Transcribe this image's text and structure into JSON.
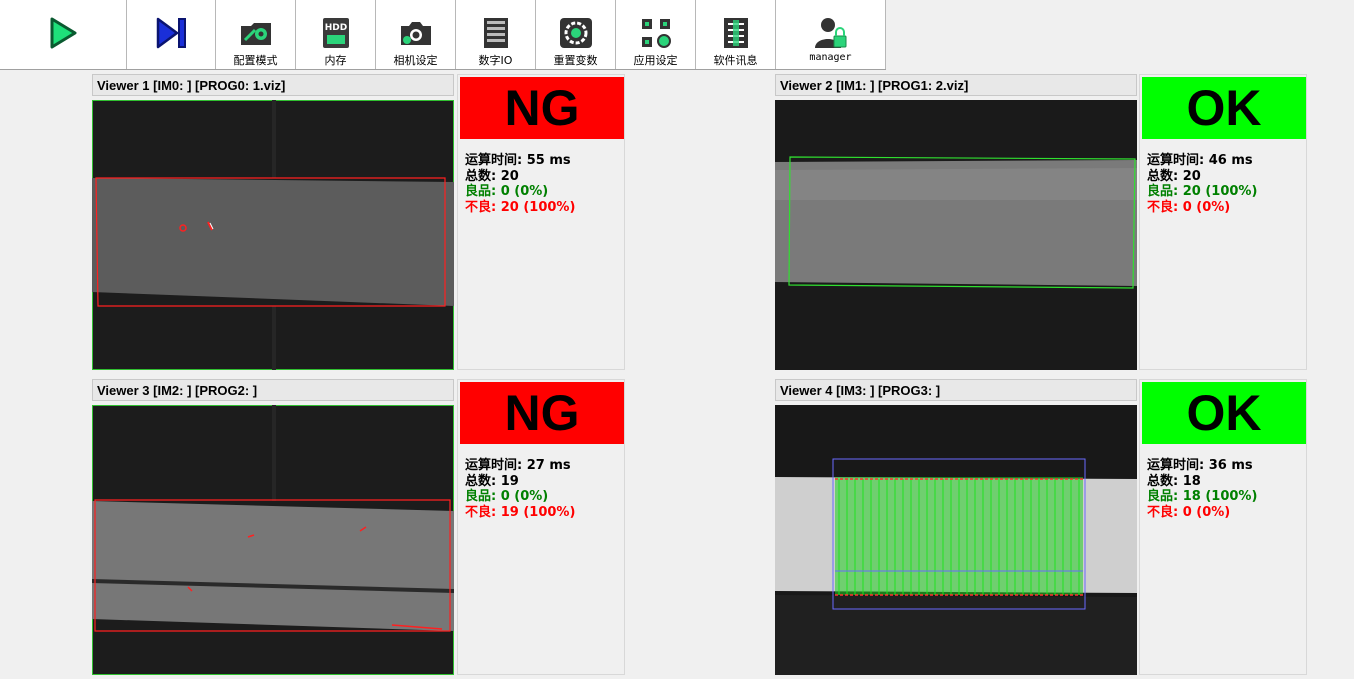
{
  "toolbar": {
    "buttons": [
      {
        "id": "run",
        "label": "",
        "icon": "play-icon"
      },
      {
        "id": "step",
        "label": "",
        "icon": "step-forward-icon"
      },
      {
        "id": "config-mode",
        "label": "配置模式",
        "icon": "folder-gear-icon"
      },
      {
        "id": "memory",
        "label": "内存",
        "icon": "hdd-icon"
      },
      {
        "id": "camera-settings",
        "label": "相机设定",
        "icon": "camera-gear-icon"
      },
      {
        "id": "digital-io",
        "label": "数字IO",
        "icon": "io-rack-icon"
      },
      {
        "id": "reset-vars",
        "label": "重置变数",
        "icon": "reset-gear-icon"
      },
      {
        "id": "app-settings",
        "label": "应用设定",
        "icon": "qr-gear-icon"
      },
      {
        "id": "software-info",
        "label": "软件讯息",
        "icon": "info-list-icon"
      },
      {
        "id": "user",
        "label": "manager",
        "icon": "user-lock-icon"
      }
    ]
  },
  "colors": {
    "ng": "#ff0000",
    "ok": "#00ff00",
    "good_text": "#008000",
    "bad_text": "#ff0000"
  },
  "viewers": [
    {
      "title": "Viewer 1 [IM0: ]  [PROG0: 1.viz]",
      "result": {
        "verdict": "NG",
        "time": "运算时间: 55 ms",
        "total": "总数: 20",
        "good": "良品: 0 (0%)",
        "bad": "不良: 20 (100%)"
      }
    },
    {
      "title": "Viewer 2 [IM1: ]  [PROG1: 2.viz]",
      "result": {
        "verdict": "OK",
        "time": "运算时间: 46 ms",
        "total": "总数: 20",
        "good": "良品: 20 (100%)",
        "bad": "不良: 0 (0%)"
      }
    },
    {
      "title": "Viewer 3 [IM2: ]  [PROG2: ]",
      "result": {
        "verdict": "NG",
        "time": "运算时间: 27 ms",
        "total": "总数: 19",
        "good": "良品: 0 (0%)",
        "bad": "不良: 19 (100%)"
      }
    },
    {
      "title": "Viewer 4 [IM3: ]  [PROG3: ]",
      "result": {
        "verdict": "OK",
        "time": "运算时间: 36 ms",
        "total": "总数: 18",
        "good": "良品: 18 (100%)",
        "bad": "不良: 0 (0%)"
      }
    }
  ]
}
